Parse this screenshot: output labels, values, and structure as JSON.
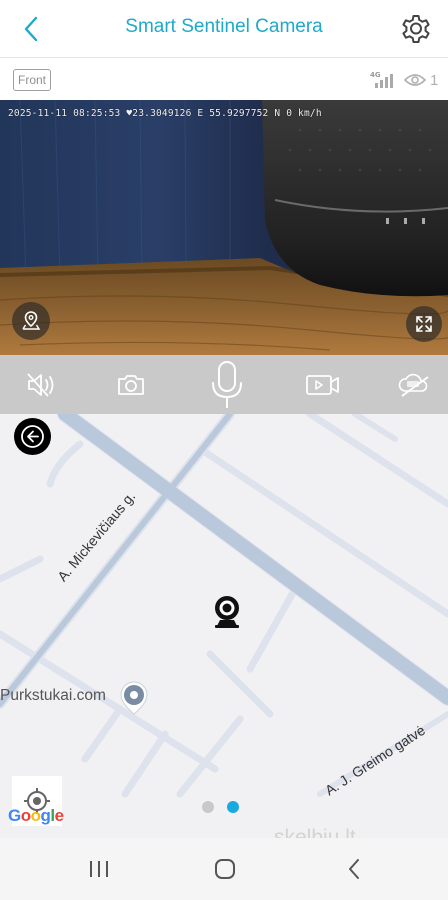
{
  "header": {
    "title": "Smart Sentinel Camera",
    "back_icon": "chevron-left-icon",
    "settings_icon": "gear-icon",
    "accent_color": "#20a9c9"
  },
  "subbar": {
    "camera_label": "Front",
    "signal_label": "4G",
    "viewer_count": "1"
  },
  "video": {
    "overlay": "2025-11-11 08:25:53 ♥23.3049126 E 55.9297752 N 0 km/h"
  },
  "controls": {
    "items": [
      "mute-icon",
      "snapshot-icon",
      "microphone-icon",
      "record-video-icon",
      "cloud-off-icon"
    ]
  },
  "map": {
    "streets": [
      "A. Mickevičiaus g.",
      "A. J. Greimo gatvė"
    ],
    "place": "Purkstukai.com",
    "provider": "Google",
    "pager": {
      "count": 2,
      "active": 2
    }
  },
  "watermark": "skelbiu.lt",
  "navbar": {
    "items": [
      "recent-apps-icon",
      "home-icon",
      "back-icon"
    ]
  }
}
